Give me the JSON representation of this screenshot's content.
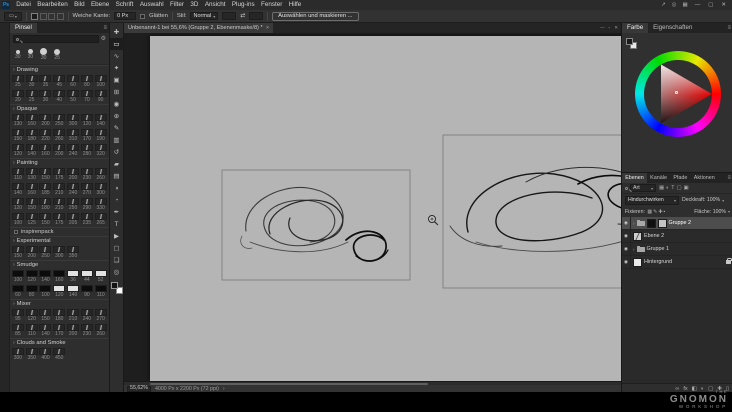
{
  "app": {
    "logo_text": "Ps"
  },
  "icons": {
    "chevron": "›",
    "eye": "◉",
    "panel_menu": "≡",
    "link_dimensions": "⇄"
  },
  "menubar": {
    "items": [
      "Datei",
      "Bearbeiten",
      "Bild",
      "Ebene",
      "Schrift",
      "Auswahl",
      "Filter",
      "3D",
      "Ansicht",
      "Plug-ins",
      "Fenster",
      "Hilfe"
    ],
    "right_icons": [
      {
        "id": "share",
        "glyph": "↗"
      },
      {
        "id": "search",
        "glyph": "◎"
      },
      {
        "id": "workspace-switcher",
        "glyph": "▦"
      }
    ]
  },
  "window_controls": [
    {
      "id": "minimize",
      "glyph": "—"
    },
    {
      "id": "maximize",
      "glyph": "▢"
    },
    {
      "id": "close",
      "glyph": "✕"
    }
  ],
  "options_bar": {
    "tool_preset_glyph": "▭",
    "selection_modes": [
      "new",
      "add",
      "subtract",
      "intersect"
    ],
    "feather_label": "Weiche Kante:",
    "feather_value": "0 Px",
    "antialias_label": "Glätten",
    "style_label": "Stil:",
    "style_value": "Normal",
    "width_value": "",
    "height_value": "",
    "select_mask_label": "Auswählen und maskieren ..."
  },
  "toolbar": {
    "tools": [
      {
        "id": "move",
        "glyph": "✚"
      },
      {
        "id": "marquee",
        "glyph": "▭",
        "active": true
      },
      {
        "id": "lasso",
        "glyph": "∿"
      },
      {
        "id": "quick-selection",
        "glyph": "✦"
      },
      {
        "id": "crop",
        "glyph": "▣"
      },
      {
        "id": "frame",
        "glyph": "⊞"
      },
      {
        "id": "eyedropper",
        "glyph": "◉"
      },
      {
        "id": "healing",
        "glyph": "⊕"
      },
      {
        "id": "brush",
        "glyph": "✎"
      },
      {
        "id": "clone-stamp",
        "glyph": "▥"
      },
      {
        "id": "history-brush",
        "glyph": "↺"
      },
      {
        "id": "eraser",
        "glyph": "▰"
      },
      {
        "id": "gradient",
        "glyph": "▤"
      },
      {
        "id": "blur",
        "glyph": "◑"
      },
      {
        "id": "dodge",
        "glyph": "◔"
      },
      {
        "id": "pen",
        "glyph": "✒"
      },
      {
        "id": "type",
        "glyph": "T"
      },
      {
        "id": "path-selection",
        "glyph": "▶"
      },
      {
        "id": "shape",
        "glyph": "▢"
      },
      {
        "id": "hand",
        "glyph": "❏"
      },
      {
        "id": "zoom",
        "glyph": "◎"
      }
    ]
  },
  "brushes_panel": {
    "tab": "Pinsel",
    "recent": [
      {
        "size": "30",
        "dot": 4
      },
      {
        "size": "30",
        "dot": 5
      },
      {
        "size": "30",
        "dot": 7
      },
      {
        "size": "25",
        "dot": 6
      }
    ],
    "sections": [
      {
        "name": "Drawing",
        "rows": [
          [
            25,
            30,
            35,
            45,
            60,
            80,
            100
          ],
          [
            20,
            25,
            30,
            40,
            50,
            70,
            90
          ]
        ]
      },
      {
        "name": "Opaque",
        "rows": [
          [
            130,
            160,
            200,
            250,
            300,
            120,
            140
          ],
          [
            150,
            180,
            220,
            260,
            310,
            170,
            190
          ],
          [
            120,
            140,
            160,
            200,
            240,
            280,
            320
          ]
        ]
      },
      {
        "name": "Painting",
        "rows": [
          [
            110,
            130,
            150,
            175,
            200,
            230,
            260
          ],
          [
            140,
            160,
            185,
            210,
            240,
            270,
            300
          ],
          [
            120,
            150,
            180,
            210,
            250,
            290,
            330
          ],
          [
            100,
            125,
            150,
            175,
            205,
            235,
            265
          ]
        ]
      },
      {
        "type": "pack",
        "label": "inspirenpack"
      },
      {
        "name": "Experimental",
        "rows": [
          [
            150,
            200,
            250,
            300,
            350
          ]
        ]
      },
      {
        "name": "Smudge",
        "rows": [
          [
            {
              "n": 100,
              "s": "d"
            },
            {
              "n": 120,
              "s": "d"
            },
            {
              "n": 140,
              "s": "d"
            },
            {
              "n": 160,
              "s": "d"
            },
            {
              "n": 36,
              "s": "w"
            },
            {
              "n": 44,
              "s": "w"
            },
            {
              "n": 52,
              "s": "w"
            }
          ],
          [
            {
              "n": 60,
              "s": "d"
            },
            {
              "n": 80,
              "s": "d"
            },
            {
              "n": 100,
              "s": "d"
            },
            {
              "n": 120,
              "s": "w"
            },
            {
              "n": 140,
              "s": "w"
            },
            {
              "n": 90,
              "s": "d"
            },
            {
              "n": 110,
              "s": "d"
            }
          ]
        ]
      },
      {
        "name": "Mixer",
        "rows": [
          [
            95,
            120,
            150,
            180,
            210,
            240,
            270
          ],
          [
            85,
            110,
            140,
            170,
            200,
            230,
            260
          ]
        ]
      },
      {
        "name": "Clouds and Smoke",
        "rows": [
          [
            300,
            350,
            400,
            450
          ]
        ]
      }
    ]
  },
  "document": {
    "tab_title": "Unbenannt-1 bei 55,6% (Gruppe 2, Ebenenmaske/8) *",
    "window_icons": [
      {
        "id": "doc-minimize",
        "glyph": "—"
      },
      {
        "id": "doc-restore",
        "glyph": "▫"
      },
      {
        "id": "doc-close",
        "glyph": "✕"
      }
    ],
    "status_zoom": "55,62%",
    "status_info": "4000 Px x 2200 Px (72 ppi)"
  },
  "color_panel": {
    "tabs": [
      {
        "label": "Farbe",
        "active": true
      },
      {
        "label": "Eigenschaften",
        "active": false
      }
    ]
  },
  "layers_panel": {
    "tabs": [
      {
        "label": "Ebenen",
        "active": true
      },
      {
        "label": "Kanäle"
      },
      {
        "label": "Pfade"
      },
      {
        "label": "Aktionen"
      }
    ],
    "filter_label": "Art",
    "filter_icons": [
      {
        "id": "filter-pixel-layers",
        "glyph": "▦"
      },
      {
        "id": "filter-adjustment-layers",
        "glyph": "◐"
      },
      {
        "id": "filter-type-layers",
        "glyph": "T"
      },
      {
        "id": "filter-shape-layers",
        "glyph": "▢"
      },
      {
        "id": "filter-smart-objects",
        "glyph": "▣"
      }
    ],
    "blend_mode": "Hindurchwirken",
    "opacity_label": "Deckkraft:",
    "opacity_value": "100%",
    "lock_label": "Fixieren:",
    "lock_icons": [
      {
        "id": "lock-transparency",
        "glyph": "▦"
      },
      {
        "id": "lock-pixels",
        "glyph": "✎"
      },
      {
        "id": "lock-position",
        "glyph": "✚"
      },
      {
        "id": "lock-all",
        "glyph": "▪"
      }
    ],
    "fill_label": "Fläche:",
    "fill_value": "100%",
    "layers": [
      {
        "name": "Gruppe 2",
        "kind": "group",
        "selected": true,
        "thumbs": [
          "dark",
          "mask"
        ]
      },
      {
        "name": "Ebene 2",
        "kind": "layer",
        "thumbs": [
          "scribble"
        ]
      },
      {
        "name": "Gruppe 1",
        "kind": "group",
        "thumbs": []
      },
      {
        "name": "Hintergrund",
        "kind": "layer",
        "locked": true,
        "thumbs": [
          "white"
        ]
      }
    ],
    "bottom_icons": [
      {
        "id": "link-layers",
        "glyph": "∞"
      },
      {
        "id": "layer-effects",
        "glyph": "fx"
      },
      {
        "id": "add-layer-mask",
        "glyph": "◧"
      },
      {
        "id": "new-adjustment-layer",
        "glyph": "◐"
      },
      {
        "id": "new-group",
        "glyph": "▢"
      },
      {
        "id": "new-layer",
        "glyph": "✚"
      },
      {
        "id": "delete-layer",
        "glyph": "▯"
      }
    ]
  },
  "watermark": {
    "top": "THE",
    "middle": "GNOMON",
    "bottom": "WORKSHOP"
  }
}
